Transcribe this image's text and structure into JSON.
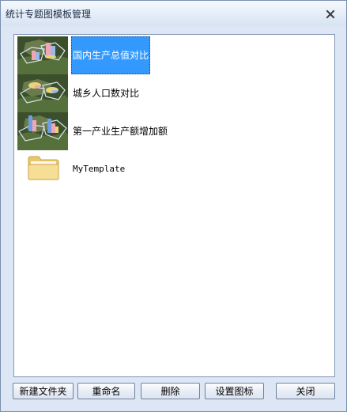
{
  "window": {
    "title": "统计专题图模板管理"
  },
  "templates": [
    {
      "label": "国内生产总值对比",
      "thumbnail": "globe-3d-bar-chart-thumbnail",
      "selected": true
    },
    {
      "label": "城乡人口数对比",
      "thumbnail": "globe-3d-pie-chart-thumbnail",
      "selected": false
    },
    {
      "label": "第一产业生产额增加额",
      "thumbnail": "globe-3d-bar-chart-thumbnail",
      "selected": false
    },
    {
      "label": "MyTemplate",
      "thumbnail": "folder-icon",
      "selected": false
    }
  ],
  "buttons": {
    "new_folder": "新建文件夹",
    "rename": "重命名",
    "delete": "删除",
    "set_icon": "设置图标",
    "close": "关闭"
  },
  "colors": {
    "selection": "#3399ff",
    "window_background": "#dce6f4",
    "list_background": "#ffffff"
  }
}
